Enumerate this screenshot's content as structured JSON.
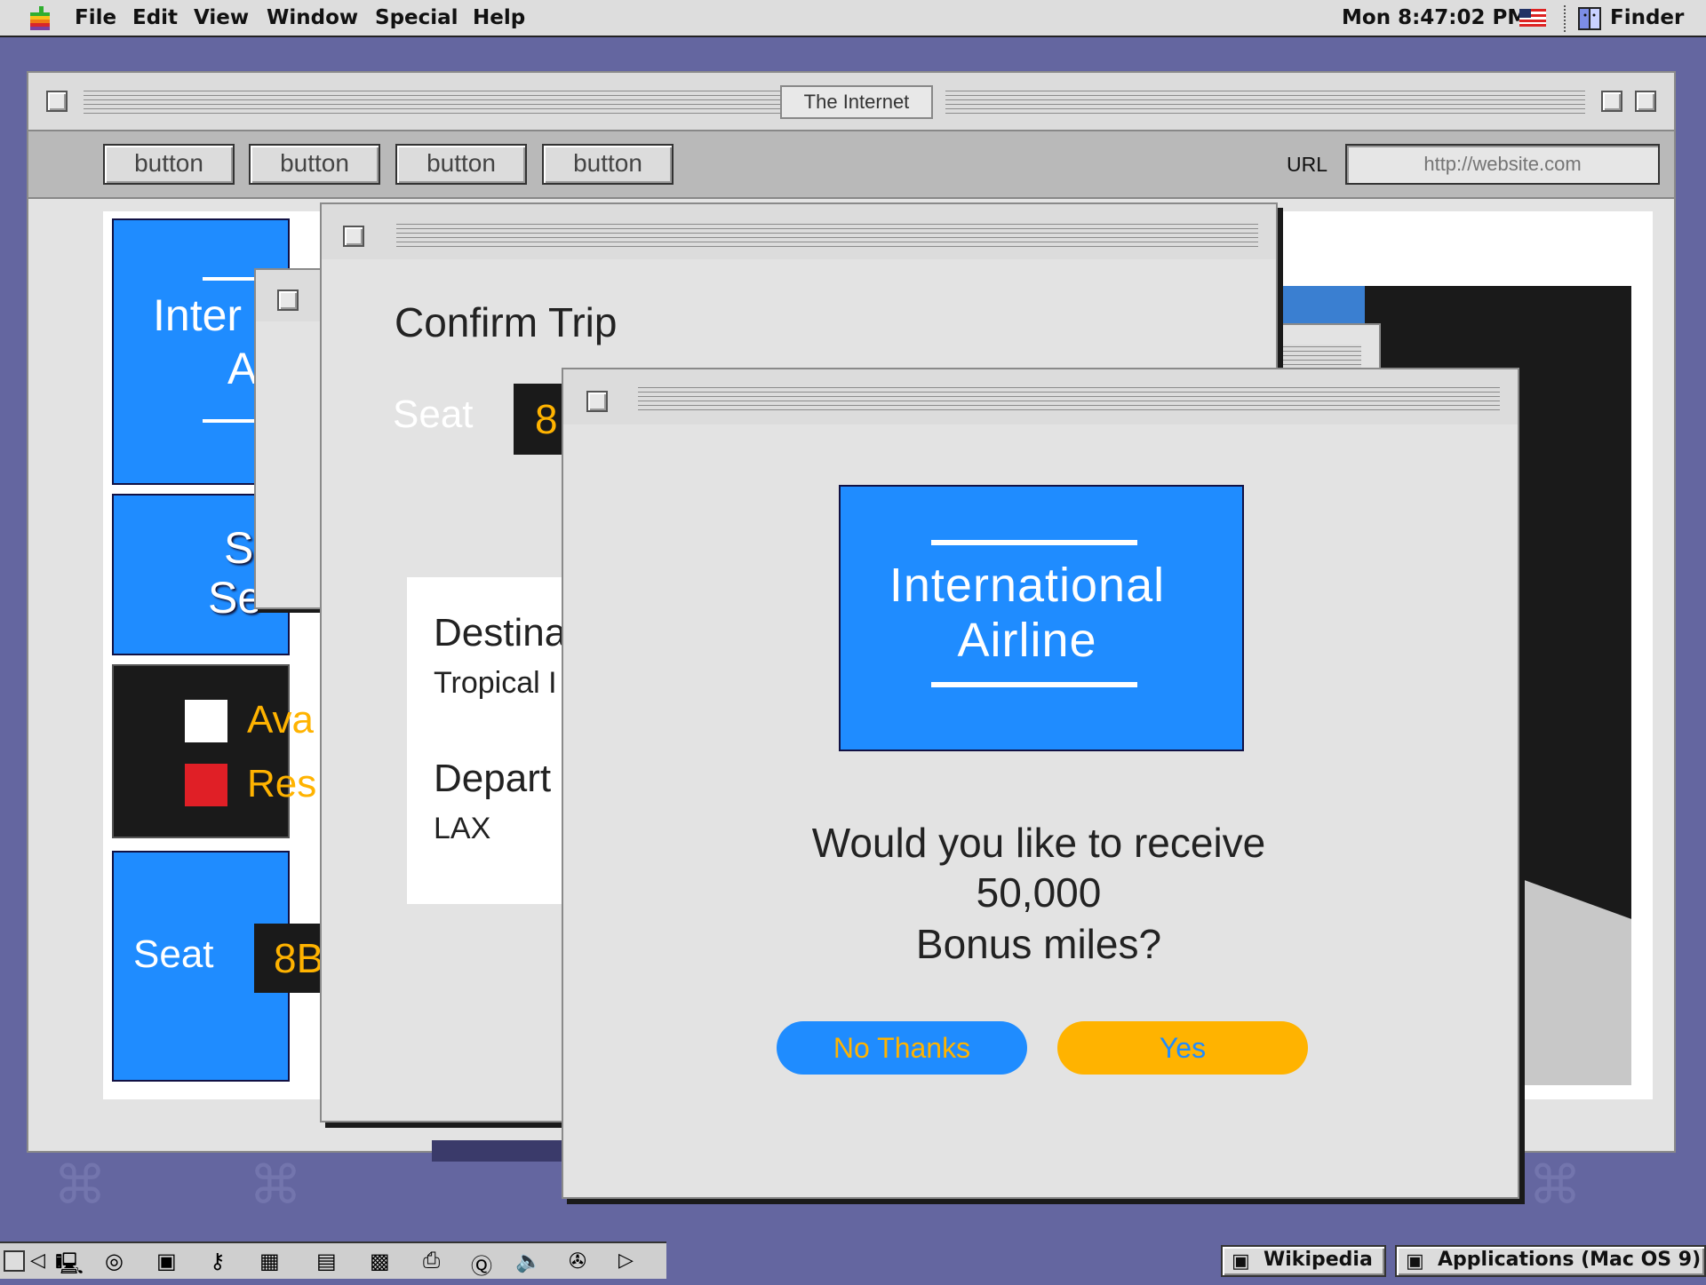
{
  "menubar": {
    "items": [
      "File",
      "Edit",
      "View",
      "Window",
      "Special",
      "Help"
    ],
    "clock": "Mon 8:47:02 PM",
    "app_name": "Finder"
  },
  "browser": {
    "title": "The Internet",
    "buttons": [
      "button",
      "button",
      "button",
      "button"
    ],
    "url_label": "URL",
    "url_placeholder": "http://website.com"
  },
  "page_behind": {
    "logo_partial": "Inter",
    "logo_partial2": "A",
    "select_partial1": "S",
    "select_partial2": "Se",
    "legend": [
      "Ava",
      "Res"
    ],
    "seat_label": "Seat",
    "seat_value": "8B"
  },
  "confirm_window": {
    "title": "Confirm Trip",
    "seat_label": "Seat",
    "seat_value": "8",
    "destination_label": "Destina",
    "destination_value": "Tropical I",
    "departure_label": "Depart",
    "departure_value": "LAX"
  },
  "dialog": {
    "logo_line1": "International",
    "logo_line2": "Airline",
    "question_line1": "Would you like to receive",
    "question_line2": "50,000",
    "question_line3": "Bonus miles?",
    "no_label": "No Thanks",
    "yes_label": "Yes"
  },
  "taskbar": {
    "tasks": [
      "Wikipedia",
      "Applications (Mac OS 9)"
    ]
  },
  "colors": {
    "desktop": "#6466a0",
    "brand_blue": "#1f8cff",
    "accent_yellow": "#ffb300",
    "window_gray": "#e3e3e3"
  }
}
